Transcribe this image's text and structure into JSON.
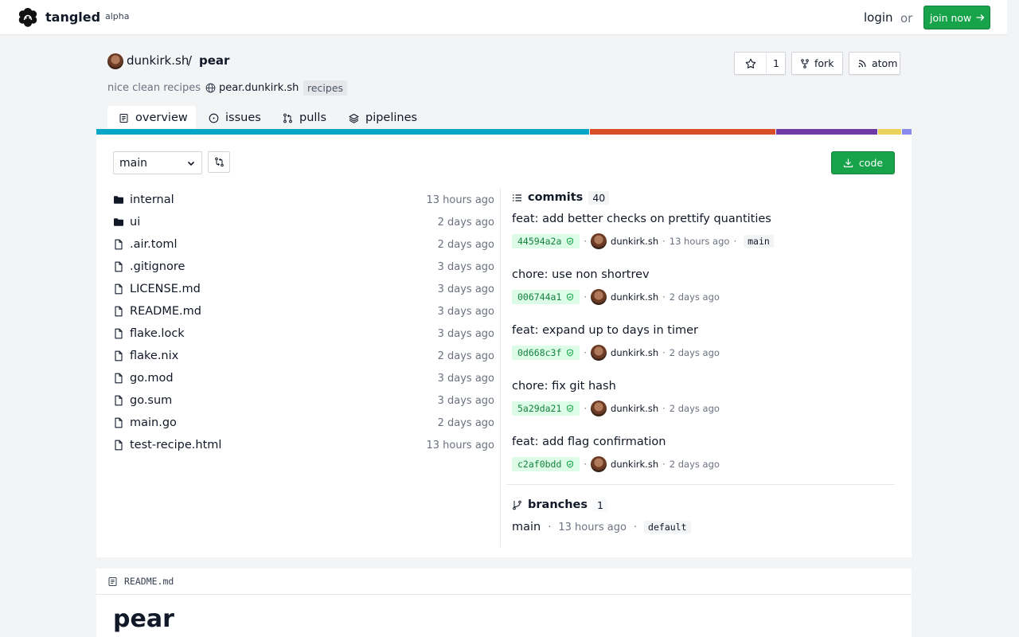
{
  "header": {
    "brand": "tangled",
    "badge": "alpha",
    "login": "login",
    "or": "or",
    "join": "join now"
  },
  "repo": {
    "owner": "dunkirk.sh",
    "separator": "/",
    "name": "pear",
    "description": "nice clean recipes",
    "website": "pear.dunkirk.sh",
    "topics": [
      "recipes"
    ],
    "star_count": "1",
    "fork_label": "fork",
    "atom_label": "atom"
  },
  "tabs": [
    {
      "label": "overview",
      "active": true,
      "icon": "file-text-icon"
    },
    {
      "label": "issues",
      "icon": "circle-dot-icon"
    },
    {
      "label": "pulls",
      "icon": "git-pull-request-icon"
    },
    {
      "label": "pipelines",
      "icon": "layers-icon"
    }
  ],
  "languages": [
    {
      "color": "#06a6c9",
      "percent": 60.5
    },
    {
      "color": "#d94f25",
      "percent": 22.9
    },
    {
      "color": "#6e3aa7",
      "percent": 12.5
    },
    {
      "color": "#e9d35c",
      "percent": 2.9
    },
    {
      "color": "#8b8bee",
      "percent": 1.2
    }
  ],
  "branch_select": {
    "value": "main"
  },
  "code_button": "code",
  "files": [
    {
      "name": "internal",
      "type": "dir",
      "time": "13 hours ago"
    },
    {
      "name": "ui",
      "type": "dir",
      "time": "2 days ago"
    },
    {
      "name": ".air.toml",
      "type": "file",
      "time": "2 days ago"
    },
    {
      "name": ".gitignore",
      "type": "file",
      "time": "3 days ago"
    },
    {
      "name": "LICENSE.md",
      "type": "file",
      "time": "3 days ago"
    },
    {
      "name": "README.md",
      "type": "file",
      "time": "3 days ago"
    },
    {
      "name": "flake.lock",
      "type": "file",
      "time": "3 days ago"
    },
    {
      "name": "flake.nix",
      "type": "file",
      "time": "2 days ago"
    },
    {
      "name": "go.mod",
      "type": "file",
      "time": "3 days ago"
    },
    {
      "name": "go.sum",
      "type": "file",
      "time": "3 days ago"
    },
    {
      "name": "main.go",
      "type": "file",
      "time": "2 days ago"
    },
    {
      "name": "test-recipe.html",
      "type": "file",
      "time": "13 hours ago"
    }
  ],
  "commits": {
    "label": "commits",
    "count": "40",
    "items": [
      {
        "title": "feat: add better checks on prettify quantities",
        "sha": "44594a2a",
        "author": "dunkirk.sh",
        "time": "13 hours ago",
        "ref": "main"
      },
      {
        "title": "chore: use non shortrev",
        "sha": "006744a1",
        "author": "dunkirk.sh",
        "time": "2 days ago"
      },
      {
        "title": "feat: expand up to days in timer",
        "sha": "0d668c3f",
        "author": "dunkirk.sh",
        "time": "2 days ago"
      },
      {
        "title": "chore: fix git hash",
        "sha": "5a29da21",
        "author": "dunkirk.sh",
        "time": "2 days ago"
      },
      {
        "title": "feat: add flag confirmation",
        "sha": "c2af0bdd",
        "author": "dunkirk.sh",
        "time": "2 days ago"
      }
    ]
  },
  "branches": {
    "label": "branches",
    "count": "1",
    "items": [
      {
        "name": "main",
        "time": "13 hours ago",
        "tag": "default"
      }
    ]
  },
  "readme": {
    "filename": "README.md",
    "title": "pear"
  }
}
